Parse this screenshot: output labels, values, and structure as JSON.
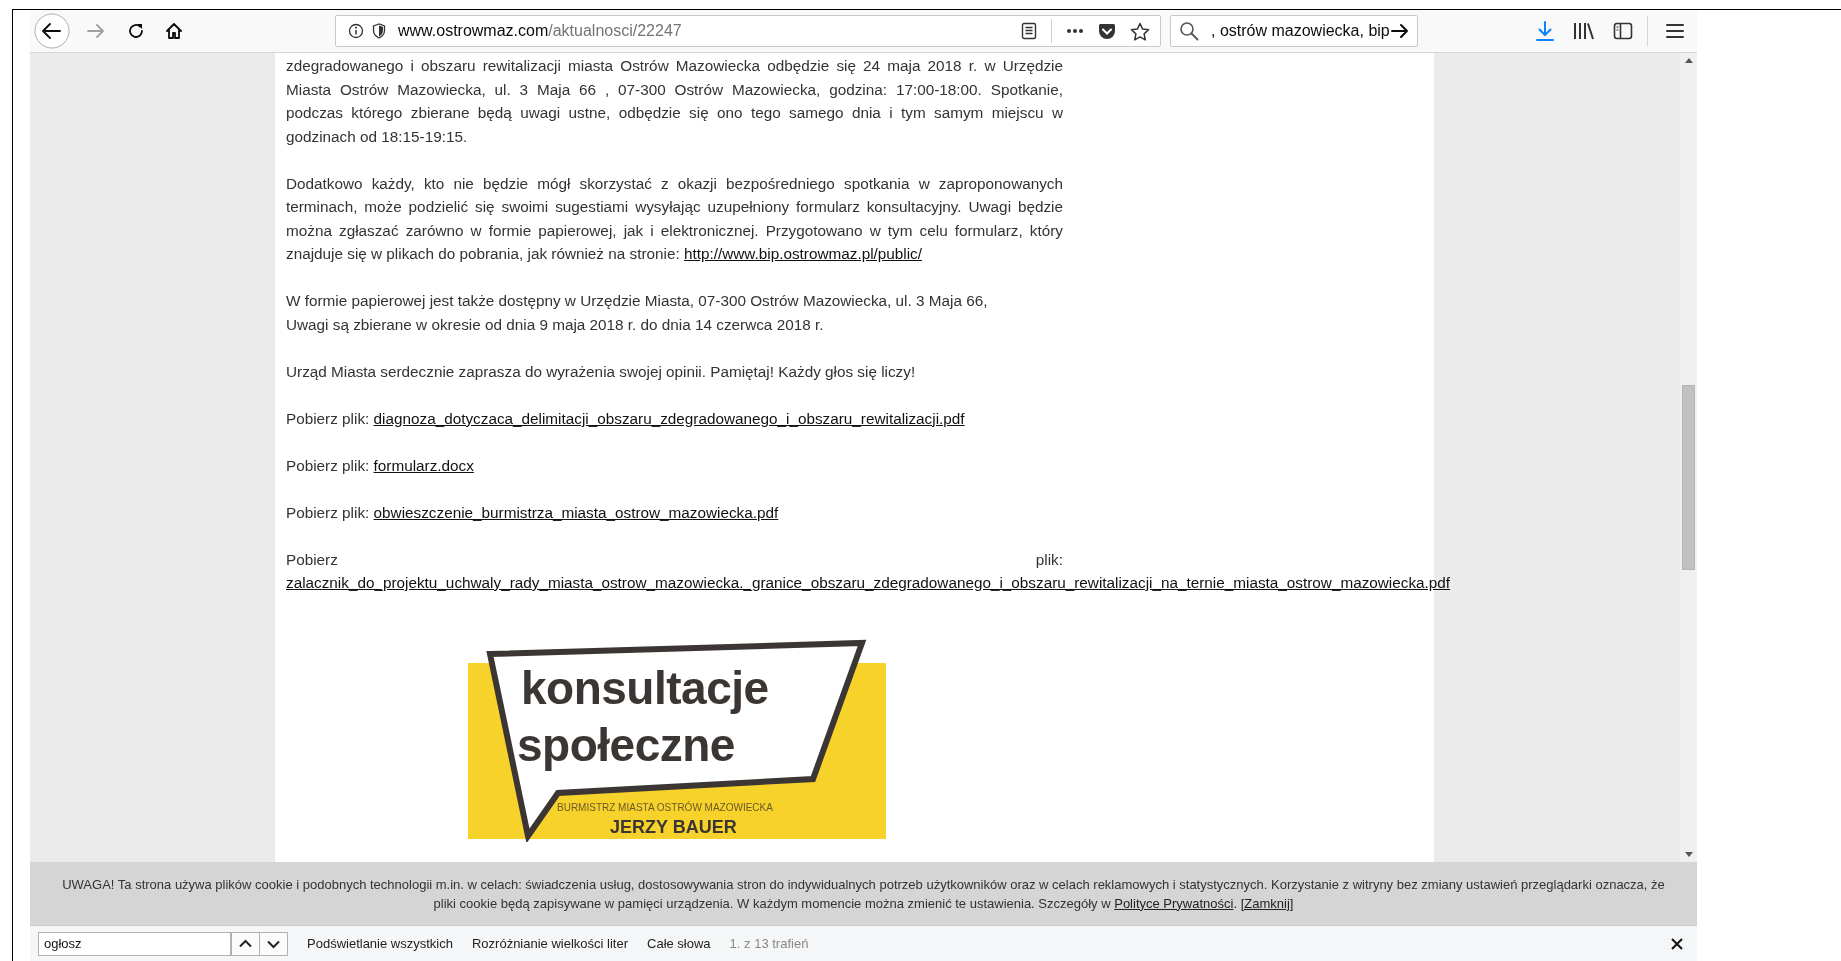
{
  "toolbar": {
    "back_disabled": false,
    "forward_disabled": true,
    "url": {
      "domain": "www.ostrowmaz.com",
      "path": "/aktualnosci/22247"
    },
    "search_value": ", ostrów mazowiecka, bip"
  },
  "article": {
    "paragraphs": [
      {
        "lines": [
          "zdegradowanego i obszaru rewitalizacji miasta Ostrów Mazowiecka odbędzie się 24 maja 2018 r. w Urzędzie Miasta Ostrów Mazowiecka, ul. 3 Maja 66 , 07-300 Ostrów Mazowiecka, godzina: 17:00-18:00. Spotkanie, podczas którego zbierane będą uwagi ustne, odbędzie się ono tego samego dnia i tym samym miejscu w godzinach od 18:15-19:15."
        ]
      },
      {
        "lines": [
          "Dodatkowo każdy, kto nie będzie mógł skorzystać z okazji bezpośredniego spotkania w zaproponowanych terminach, może podzielić się swoimi sugestiami wysyłając uzupełniony formularz konsultacyjny. Uwagi będzie można zgłaszać zarówno w formie papierowej, jak i elektronicznej. Przygotowano w tym celu formularz, który znajduje się w plikach do pobrania, jak również na stronie:"
        ],
        "link": "http://www.bip.ostrowmaz.pl/public/"
      },
      {
        "lines": [
          "W formie papierowej jest także dostępny w Urzędzie Miasta, 07-300 Ostrów Mazowiecka, ul. 3 Maja 66,",
          "Uwagi są zbierane w okresie od dnia 9 maja 2018 r. do dnia 14 czerwca 2018 r."
        ]
      },
      {
        "lines": [
          "Urząd Miasta serdecznie zaprasza do wyrażenia swojej opinii. Pamiętaj! Każdy głos się liczy!"
        ]
      }
    ],
    "downloads": [
      {
        "kind": "inline",
        "label": "Pobierz plik:",
        "file": "diagnoza_dotyczaca_delimitacji_obszaru_zdegradowanego_i_obszaru_rewitalizacji.pdf"
      },
      {
        "kind": "inline",
        "label": "Pobierz plik:",
        "file": "formularz.docx"
      },
      {
        "kind": "inline",
        "label": "Pobierz plik:",
        "file": "obwieszczenie_burmistrza_miasta_ostrow_mazowiecka.pdf"
      },
      {
        "kind": "block",
        "label": "Pobierz plik:",
        "file": "zalacznik_do_projektu_uchwaly_rady_miasta_ostrow_mazowiecka._granice_obszaru_zdegradowanego_i_obszaru_rewitalizacji_na_ternie_miasta_ostrow_mazowiecka.pdf"
      }
    ],
    "poster": {
      "title_lines": [
        "konsultacje",
        "społeczne"
      ],
      "subtitle": "BURMISTRZ MIASTA OSTRÓW MAZOWIECKA",
      "name": "JERZY BAUER"
    }
  },
  "cookie_notice": {
    "text": "UWAGA! Ta strona używa plików cookie i podobnych technologii m.in. w celach: świadczenia usług, dostosowywania stron do indywidualnych potrzeb użytkowników oraz w celach reklamowych i statystycznych. Korzystanie z witryny bez zmiany ustawień przeglądarki oznacza, że pliki cookie będą zapisywane w pamięci urządzenia. W każdym momencie można zmienić te ustawienia. Szczegóły w",
    "policy_link": "Polityce Prywatności",
    "after": ".",
    "close_link": "[Zamknij]"
  },
  "find_bar": {
    "query": "ogłosz",
    "options": [
      {
        "label": "Podświetlanie wszystkich"
      },
      {
        "label": "Rozróżnianie wielkości liter"
      },
      {
        "label": "Całe słowa"
      }
    ],
    "status": "1. z 13 trafień"
  }
}
